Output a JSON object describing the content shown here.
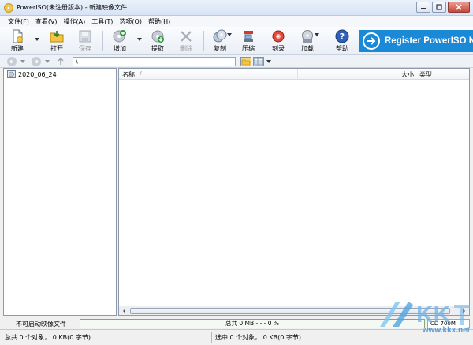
{
  "window": {
    "title": "PowerISO(未注册版本) - 新建映像文件"
  },
  "menu": [
    "文件(F)",
    "查看(V)",
    "操作(A)",
    "工具(T)",
    "选项(O)",
    "帮助(H)"
  ],
  "toolbar": {
    "new": "新建",
    "open": "打开",
    "save": "保存",
    "add": "增加",
    "extract": "提取",
    "delete": "删除",
    "copy": "复制",
    "compress": "压缩",
    "burn": "刻录",
    "mount": "加载",
    "help": "帮助"
  },
  "banner": {
    "text": "Register PowerISO Now"
  },
  "address": {
    "path": "\\"
  },
  "tree": {
    "root": "2020_06_24"
  },
  "columns": {
    "name": "名称",
    "sort_marker": "/",
    "size": "大小",
    "type": "类型"
  },
  "status": {
    "bootable": "不可启动映像文件",
    "total": "总共 0 MB   - - -  0 %",
    "media": "CD 700M",
    "left": "总共 0 个对象，  0 KB(0 字节)",
    "right": "选中 0 个对象，  0 KB(0 字节)"
  },
  "watermark": {
    "url": "www.kkx.net"
  },
  "colors": {
    "banner": "#1a8ad8",
    "progress_border": "#7fa97a",
    "watermark": "#5b9bd4"
  }
}
